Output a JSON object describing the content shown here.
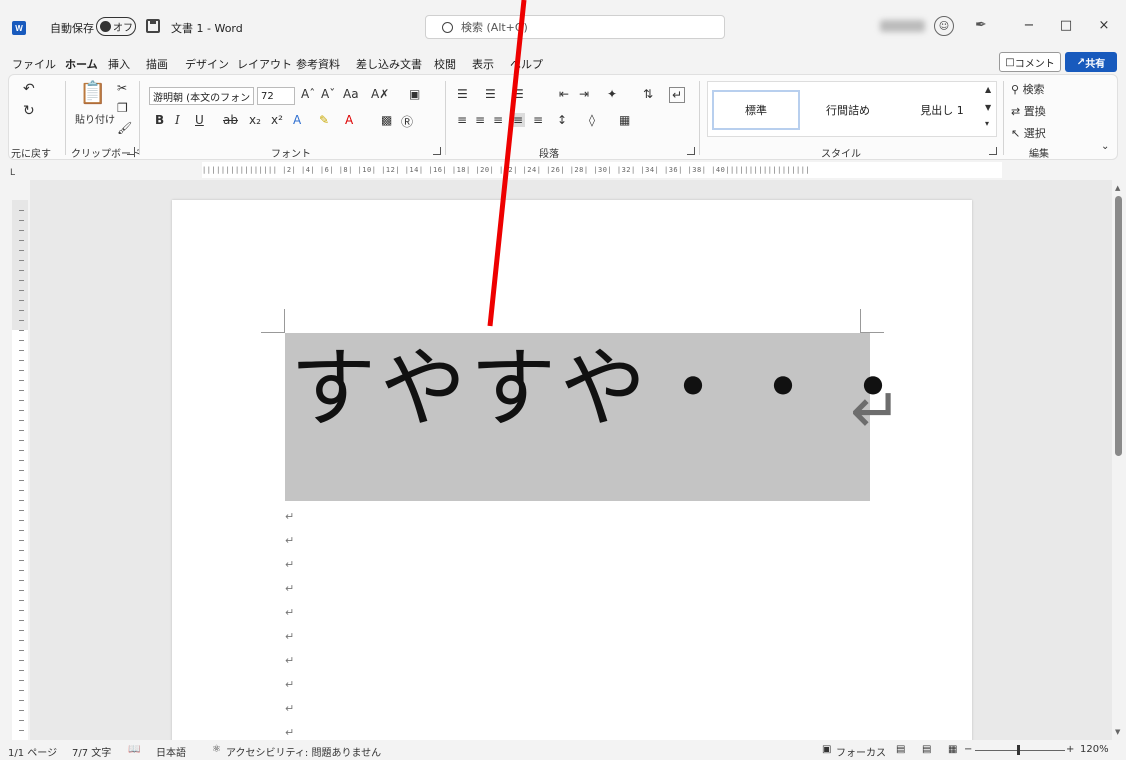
{
  "titlebar": {
    "app_icon": "W",
    "autosave_label": "自動保存",
    "autosave_state": "オフ",
    "doc_title": "文書 1 - Word",
    "search_placeholder": "検索 (Alt+Q)",
    "minimize": "−",
    "maximize": "□",
    "close": "×"
  },
  "tabs": [
    "ファイル",
    "ホーム",
    "挿入",
    "描画",
    "デザイン",
    "レイアウト",
    "参考資料",
    "差し込み文書",
    "校閲",
    "表示",
    "ヘルプ"
  ],
  "header_buttons": {
    "comment": "コメント",
    "share": "共有"
  },
  "ribbon": {
    "undo_group": "元に戻す",
    "clipboard_group": "クリップボード",
    "paste_label": "貼り付け",
    "font_group": "フォント",
    "font_name": "游明朝 (本文のフォン",
    "font_size": "72",
    "paragraph_group": "段落",
    "styles_group": "スタイル",
    "styles": [
      "標準",
      "行間詰め",
      "見出し 1"
    ],
    "editing_group": "編集",
    "find": "検索",
    "replace": "置換",
    "select": "選択"
  },
  "document": {
    "main_text": "すやすや・・・",
    "return_mark": "↵",
    "para_mark": "↵"
  },
  "ruler": {
    "h_ticks": "|||||||||||||||| |2| |4| |6| |8| |10| |12| |14| |16| |18| |20| |22| |24| |26| |28| |30| |32| |34| |36| |38| |40||||||||||||||||||"
  },
  "statusbar": {
    "page": "1/1 ページ",
    "words": "7/7 文字",
    "language": "日本語",
    "accessibility": "アクセシビリティ: 問題ありません",
    "focus": "フォーカス",
    "zoom_minus": "−",
    "zoom_plus": "+",
    "zoom": "120%"
  },
  "colors": {
    "accent": "#185abd",
    "selection": "#c4c4c4",
    "annotation": "#ee0000"
  }
}
